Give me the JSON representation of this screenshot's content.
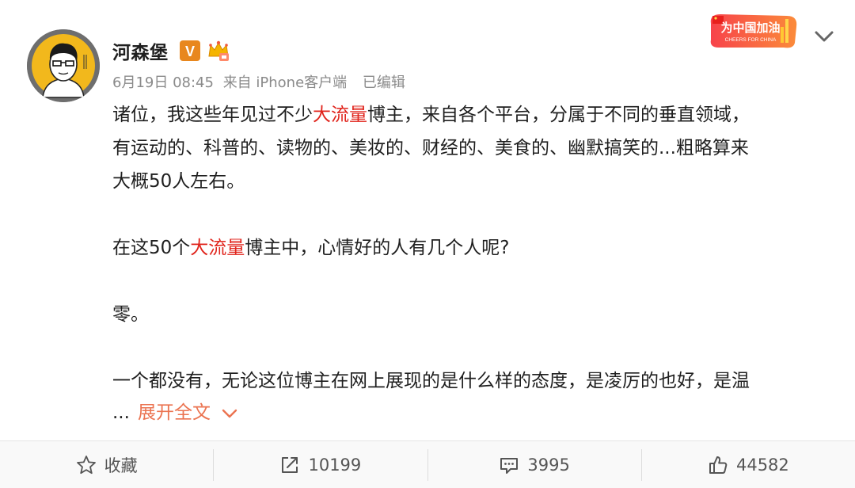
{
  "post": {
    "author": {
      "name": "河森堡",
      "verified_badge": "V",
      "avatar_icon": "avatar-icon",
      "member_icon": "crown-icon"
    },
    "meta": {
      "date": "6月19日 08:45",
      "source": "来自 iPhone客户端",
      "edited": "已编辑"
    },
    "badge": {
      "line1": "为中国加油",
      "line2": "CHEERS FOR CHINA"
    },
    "content": {
      "p1": {
        "pre": "诸位，我这些年见过不少",
        "highlight": "大流量",
        "post": "博主，来自各个平台，分属于不同的垂直领域，"
      },
      "p1_line2": "有运动的、科普的、读物的、美妆的、财经的、美食的、幽默搞笑的...粗略算来",
      "p1_line3": "大概50人左右。",
      "p2": {
        "pre": "在这50个",
        "highlight": "大流量",
        "post": "博主中，心情好的人有几个人呢?"
      },
      "p3": "零。",
      "p4": "一个都没有，无论这位博主在网上展现的是什么样的态度，是凌厉的也好，是温",
      "ellipsis": "...",
      "expand": "展开全文"
    },
    "actions": {
      "favorite": {
        "label": "收藏",
        "icon": "star-icon"
      },
      "repost": {
        "count": "10199",
        "icon": "repost-icon"
      },
      "comment": {
        "count": "3995",
        "icon": "comment-icon"
      },
      "like": {
        "count": "44582",
        "icon": "thumbs-up-icon"
      }
    },
    "colors": {
      "highlight": "#e0241c",
      "expand": "#eb7350",
      "meta": "#8a8a8a",
      "v_badge": "#e8871e"
    }
  }
}
